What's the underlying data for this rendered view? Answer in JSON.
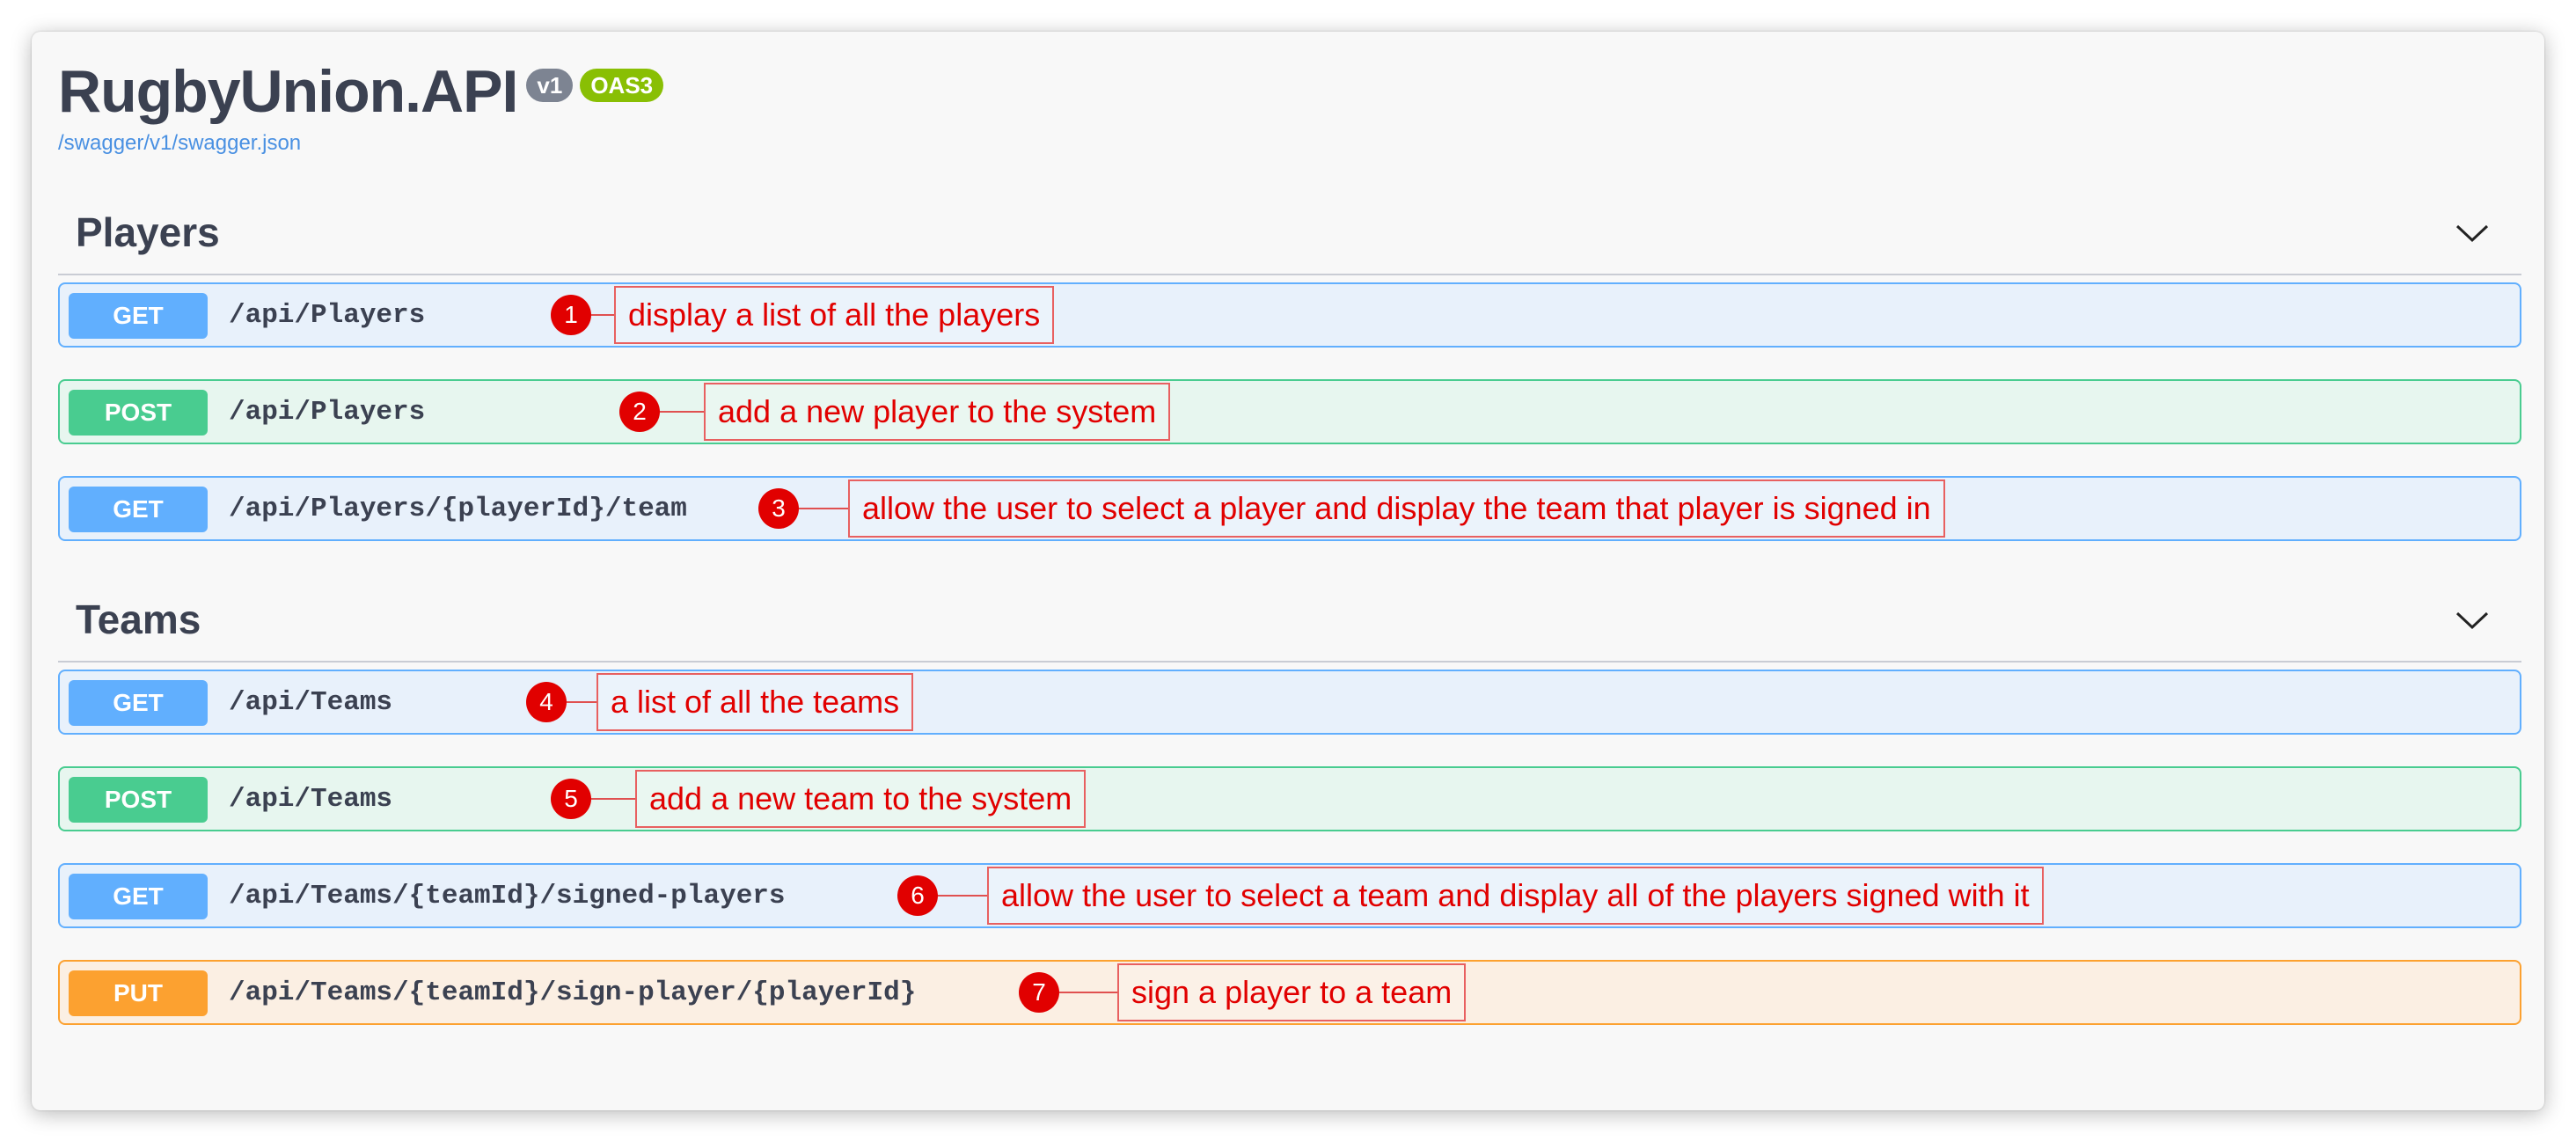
{
  "api": {
    "title": "RugbyUnion.API",
    "version_badge": "v1",
    "oas_badge": "OAS3",
    "spec_link": "/swagger/v1/swagger.json"
  },
  "tags": [
    {
      "name": "Players",
      "operations": [
        {
          "method": "GET",
          "path": "/api/Players",
          "note_number": "1",
          "note": "display a list of all the players"
        },
        {
          "method": "POST",
          "path": "/api/Players",
          "note_number": "2",
          "note": "add a new player to the system"
        },
        {
          "method": "GET",
          "path": "/api/Players/{playerId}/team",
          "note_number": "3",
          "note": "allow the user to select a player and display the team that player is signed in"
        }
      ]
    },
    {
      "name": "Teams",
      "operations": [
        {
          "method": "GET",
          "path": "/api/Teams",
          "note_number": "4",
          "note": "a list of all the teams"
        },
        {
          "method": "POST",
          "path": "/api/Teams",
          "note_number": "5",
          "note": "add a new team to the system"
        },
        {
          "method": "GET",
          "path": "/api/Teams/{teamId}/signed-players",
          "note_number": "6",
          "note": "allow the user to select a team and display all of the players signed with it"
        },
        {
          "method": "PUT",
          "path": "/api/Teams/{teamId}/sign-player/{playerId}",
          "note_number": "7",
          "note": "sign a player to a team"
        }
      ]
    }
  ],
  "icons": {
    "collapse": "chevron-down-icon"
  },
  "colors": {
    "get": "#61affe",
    "post": "#49cc90",
    "put": "#fca130",
    "annotation": "#e10000",
    "title": "#3b4151"
  }
}
